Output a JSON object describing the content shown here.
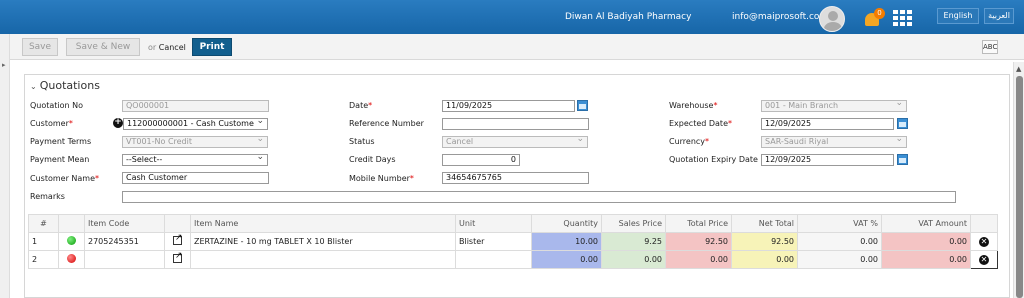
{
  "header": {
    "pharmacy_name": "Diwan Al Badiyah Pharmacy",
    "user_email": "info@maiprosoft.com",
    "notification_count": "0",
    "lang_english": "English",
    "lang_arabic": "العربية",
    "brand_color": "#1d6fb0"
  },
  "toolbar": {
    "save_label": "Save",
    "save_new_label": "Save & New",
    "or_label": "or",
    "cancel_label": "Cancel",
    "print_label": "Print",
    "spell_label": "ABC"
  },
  "panel": {
    "title": "Quotations"
  },
  "form": {
    "quotation_no_label": "Quotation No",
    "quotation_no": "QO000001",
    "customer_label": "Customer",
    "customer_value": "112000000001 - Cash Custome",
    "payment_terms_label": "Payment Terms",
    "payment_terms_value": "VT001-No Credit",
    "payment_mean_label": "Payment Mean",
    "payment_mean_value": "--Select--",
    "customer_name_label": "Customer Name",
    "customer_name_value": "Cash Customer",
    "remarks_label": "Remarks",
    "remarks_value": "",
    "date_label": "Date",
    "date_value": "11/09/2025",
    "reference_label": "Reference Number",
    "reference_value": "",
    "status_label": "Status",
    "status_value": "Cancel",
    "credit_days_label": "Credit Days",
    "credit_days_value": "0",
    "mobile_label": "Mobile Number",
    "mobile_value": "34654675765",
    "warehouse_label": "Warehouse",
    "warehouse_value": "001 - Main Branch",
    "expected_date_label": "Expected Date",
    "expected_date_value": "12/09/2025",
    "currency_label": "Currency",
    "currency_value": "SAR-Saudi Riyal",
    "expiry_label": "Quotation Expiry Date",
    "expiry_value": "12/09/2025"
  },
  "table": {
    "headers": {
      "num": "#",
      "item_code": "Item Code",
      "item_name": "Item Name",
      "unit": "Unit",
      "quantity": "Quantity",
      "sales_price": "Sales Price",
      "total_price": "Total Price",
      "net_total": "Net Total",
      "vat_pct": "VAT %",
      "vat_amount": "VAT Amount"
    },
    "rows": [
      {
        "num": "1",
        "status": "green",
        "item_code": "2705245351",
        "item_name": "ZERTAZINE - 10 mg TABLET X 10 Blister",
        "unit": "Blister",
        "quantity": "10.00",
        "sales_price": "9.25",
        "total_price": "92.50",
        "net_total": "92.50",
        "vat_pct": "0.00",
        "vat_amount": "0.00"
      },
      {
        "num": "2",
        "status": "red",
        "item_code": "",
        "item_name": "",
        "unit": "",
        "quantity": "0.00",
        "sales_price": "0.00",
        "total_price": "0.00",
        "net_total": "0.00",
        "vat_pct": "0.00",
        "vat_amount": "0.00"
      }
    ]
  }
}
